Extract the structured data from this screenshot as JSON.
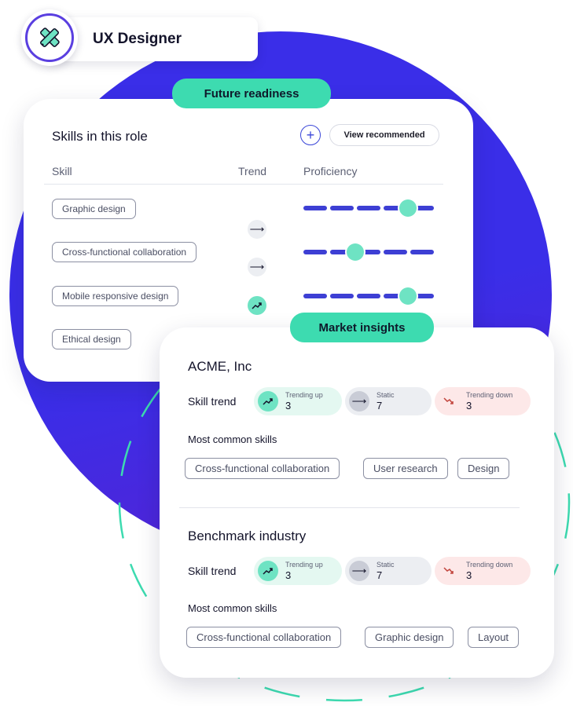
{
  "role": {
    "title": "UX Designer",
    "icon": "design-tools-icon"
  },
  "skills_card": {
    "badge": "Future readiness",
    "title": "Skills in this role",
    "add_icon": "plus-icon",
    "view_recommended_label": "View recommended",
    "columns": {
      "skill": "Skill",
      "trend": "Trend",
      "proficiency": "Proficiency"
    },
    "skills": [
      {
        "name": "Graphic design",
        "proficiency": 0.8
      },
      {
        "name": "Cross-functional collaboration",
        "trend": "static",
        "proficiency": 0.4
      },
      {
        "name": "Mobile responsive design",
        "trend": "static",
        "proficiency": 0.8
      },
      {
        "name": "Ethical design",
        "trend": "trending-up"
      }
    ]
  },
  "market_card": {
    "badge": "Market insights",
    "sections": [
      {
        "title": "ACME, Inc",
        "skill_trend_label": "Skill trend",
        "trends": [
          {
            "label": "Trending up",
            "value": "3",
            "icon": "trending-up-icon"
          },
          {
            "label": "Static",
            "value": "7",
            "icon": "arrow-right-icon"
          },
          {
            "label": "Trending down",
            "value": "3",
            "icon": "trending-down-icon"
          }
        ],
        "common_skills_label": "Most common skills",
        "common_skills": [
          "Cross-functional collaboration",
          "User research",
          "Design"
        ]
      },
      {
        "title": "Benchmark industry",
        "skill_trend_label": "Skill trend",
        "trends": [
          {
            "label": "Trending up",
            "value": "3",
            "icon": "trending-up-icon"
          },
          {
            "label": "Static",
            "value": "7",
            "icon": "arrow-right-icon"
          },
          {
            "label": "Trending down",
            "value": "3",
            "icon": "trending-down-icon"
          }
        ],
        "common_skills_label": "Most common skills",
        "common_skills": [
          "Cross-functional collaboration",
          "Graphic design",
          "Layout"
        ]
      }
    ]
  },
  "colors": {
    "brand_blue": "#3a2ee8",
    "accent_green": "#3ddbb0",
    "trend_up_bg": "#e4f8f1",
    "static_bg": "#eceef2",
    "trend_down_bg": "#fde8e8",
    "trend_down": "#c2453d"
  }
}
